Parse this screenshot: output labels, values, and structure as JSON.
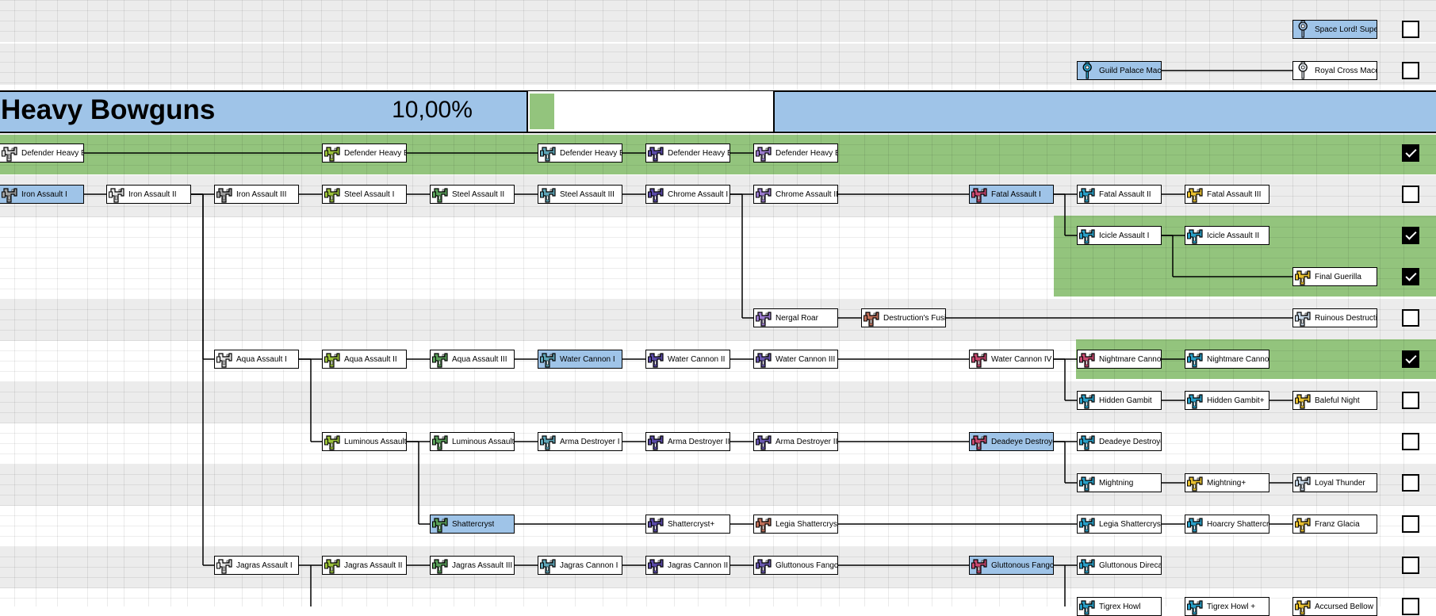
{
  "section": {
    "title": "Heavy Bowguns",
    "percent": "10,00%",
    "progress": 0.1
  },
  "colors": {
    "highlight": "#9fc4e8",
    "complete": "#93c47d",
    "grid_band": "#ececec",
    "icon_palette": [
      "#9e9e9e",
      "#e6e6e6",
      "#9bc23a",
      "#5aa05a",
      "#5fa6b8",
      "#6a58b0",
      "#9c7bd0",
      "#c0705a",
      "#c84a70",
      "#2aa0c8",
      "#e8c030",
      "#c8d8e8"
    ]
  },
  "icons": {
    "heavy_bowgun": "heavy-bowgun-icon",
    "hammer": "hammer-icon"
  },
  "weapon_nodes": [
    {
      "label": "Space Lord! Super-",
      "icon": "hammer-icon",
      "color": "#9bb8d8",
      "highlight": true
    },
    {
      "label": "Guild Palace Mace",
      "icon": "hammer-icon",
      "color": "#2aa0c8",
      "highlight": true
    },
    {
      "label": "Royal Cross Mace",
      "icon": "hammer-icon",
      "color": "#e8eef4",
      "highlight": false
    },
    {
      "label": "Defender Heavy Bo",
      "icon": "heavy-bowgun-icon",
      "color": "#d8d8d8",
      "highlight": false
    },
    {
      "label": "Defender Heavy Bo",
      "icon": "heavy-bowgun-icon",
      "color": "#9bc23a",
      "highlight": false
    },
    {
      "label": "Defender Heavy Bo",
      "icon": "heavy-bowgun-icon",
      "color": "#5fa6b8",
      "highlight": false
    },
    {
      "label": "Defender Heavy Bo",
      "icon": "heavy-bowgun-icon",
      "color": "#5a4aa8",
      "highlight": false
    },
    {
      "label": "Defender Heavy Bo",
      "icon": "heavy-bowgun-icon",
      "color": "#9c7bd0",
      "highlight": false
    },
    {
      "label": "Iron Assault I",
      "icon": "heavy-bowgun-icon",
      "color": "#9e9e9e",
      "highlight": true
    },
    {
      "label": "Iron Assault II",
      "icon": "heavy-bowgun-icon",
      "color": "#e6e6e6",
      "highlight": false
    },
    {
      "label": "Iron Assault III",
      "icon": "heavy-bowgun-icon",
      "color": "#9e9e9e",
      "highlight": false
    },
    {
      "label": "Steel Assault I",
      "icon": "heavy-bowgun-icon",
      "color": "#9bc23a",
      "highlight": false
    },
    {
      "label": "Steel Assault II",
      "icon": "heavy-bowgun-icon",
      "color": "#5aa05a",
      "highlight": false
    },
    {
      "label": "Steel Assault III",
      "icon": "heavy-bowgun-icon",
      "color": "#5fa6b8",
      "highlight": false
    },
    {
      "label": "Chrome Assault I",
      "icon": "heavy-bowgun-icon",
      "color": "#5a4aa8",
      "highlight": false
    },
    {
      "label": "Chrome Assault II",
      "icon": "heavy-bowgun-icon",
      "color": "#9c7bd0",
      "highlight": false
    },
    {
      "label": "Fatal Assault I",
      "icon": "heavy-bowgun-icon",
      "color": "#c84a70",
      "highlight": true
    },
    {
      "label": "Fatal Assault II",
      "icon": "heavy-bowgun-icon",
      "color": "#2aa0c8",
      "highlight": false
    },
    {
      "label": "Fatal Assault III",
      "icon": "heavy-bowgun-icon",
      "color": "#e8c030",
      "highlight": false
    },
    {
      "label": "Icicle Assault I",
      "icon": "heavy-bowgun-icon",
      "color": "#2aa0c8",
      "highlight": false
    },
    {
      "label": "Icicle Assault II",
      "icon": "heavy-bowgun-icon",
      "color": "#2aa0c8",
      "highlight": false
    },
    {
      "label": "Final Guerilla",
      "icon": "heavy-bowgun-icon",
      "color": "#e8c030",
      "highlight": false
    },
    {
      "label": "Nergal Roar",
      "icon": "heavy-bowgun-icon",
      "color": "#9c7bd0",
      "highlight": false
    },
    {
      "label": "Destruction's Fusill",
      "icon": "heavy-bowgun-icon",
      "color": "#c0705a",
      "highlight": false
    },
    {
      "label": "Ruinous Destruction",
      "icon": "heavy-bowgun-icon",
      "color": "#c8d8e8",
      "highlight": false
    },
    {
      "label": "Aqua Assault I",
      "icon": "heavy-bowgun-icon",
      "color": "#e6e6e6",
      "highlight": false
    },
    {
      "label": "Aqua Assault II",
      "icon": "heavy-bowgun-icon",
      "color": "#9bc23a",
      "highlight": false
    },
    {
      "label": "Aqua Assault III",
      "icon": "heavy-bowgun-icon",
      "color": "#5aa05a",
      "highlight": false
    },
    {
      "label": "Water Cannon I",
      "icon": "heavy-bowgun-icon",
      "color": "#5fa6b8",
      "highlight": true
    },
    {
      "label": "Water Cannon II",
      "icon": "heavy-bowgun-icon",
      "color": "#5a4aa8",
      "highlight": false
    },
    {
      "label": "Water Cannon III",
      "icon": "heavy-bowgun-icon",
      "color": "#6a58b0",
      "highlight": false
    },
    {
      "label": "Water Cannon IV",
      "icon": "heavy-bowgun-icon",
      "color": "#c84a70",
      "highlight": false
    },
    {
      "label": "Nightmare Cannon",
      "icon": "heavy-bowgun-icon",
      "color": "#c84a70",
      "highlight": false
    },
    {
      "label": "Nightmare Cannon",
      "icon": "heavy-bowgun-icon",
      "color": "#2aa0c8",
      "highlight": false
    },
    {
      "label": "Hidden Gambit",
      "icon": "heavy-bowgun-icon",
      "color": "#2aa0c8",
      "highlight": false
    },
    {
      "label": "Hidden Gambit+",
      "icon": "heavy-bowgun-icon",
      "color": "#2aa0c8",
      "highlight": false
    },
    {
      "label": "Baleful Night",
      "icon": "heavy-bowgun-icon",
      "color": "#e8c030",
      "highlight": false
    },
    {
      "label": "Luminous Assault I",
      "icon": "heavy-bowgun-icon",
      "color": "#9bc23a",
      "highlight": false
    },
    {
      "label": "Luminous Assault II",
      "icon": "heavy-bowgun-icon",
      "color": "#5aa05a",
      "highlight": false
    },
    {
      "label": "Arma Destroyer I",
      "icon": "heavy-bowgun-icon",
      "color": "#5fa6b8",
      "highlight": false
    },
    {
      "label": "Arma Destroyer II",
      "icon": "heavy-bowgun-icon",
      "color": "#5a4aa8",
      "highlight": false
    },
    {
      "label": "Arma Destroyer III",
      "icon": "heavy-bowgun-icon",
      "color": "#6a58b0",
      "highlight": false
    },
    {
      "label": "Deadeye Destroyer",
      "icon": "heavy-bowgun-icon",
      "color": "#c84a70",
      "highlight": true
    },
    {
      "label": "Deadeye Destroyer",
      "icon": "heavy-bowgun-icon",
      "color": "#2aa0c8",
      "highlight": false
    },
    {
      "label": "Mightning",
      "icon": "heavy-bowgun-icon",
      "color": "#2aa0c8",
      "highlight": false
    },
    {
      "label": "Mightning+",
      "icon": "heavy-bowgun-icon",
      "color": "#e8c030",
      "highlight": false
    },
    {
      "label": "Loyal Thunder",
      "icon": "heavy-bowgun-icon",
      "color": "#c8d8e8",
      "highlight": false
    },
    {
      "label": "Shattercryst",
      "icon": "heavy-bowgun-icon",
      "color": "#5aa05a",
      "highlight": true
    },
    {
      "label": "Shattercryst+",
      "icon": "heavy-bowgun-icon",
      "color": "#5a4aa8",
      "highlight": false
    },
    {
      "label": "Legia Shattercryst",
      "icon": "heavy-bowgun-icon",
      "color": "#c0705a",
      "highlight": false
    },
    {
      "label": "Legia Shattercryst+",
      "icon": "heavy-bowgun-icon",
      "color": "#2aa0c8",
      "highlight": false
    },
    {
      "label": "Hoarcry Shattercrys",
      "icon": "heavy-bowgun-icon",
      "color": "#2aa0c8",
      "highlight": false
    },
    {
      "label": "Franz Glacia",
      "icon": "heavy-bowgun-icon",
      "color": "#e8c030",
      "highlight": false
    },
    {
      "label": "Jagras Assault I",
      "icon": "heavy-bowgun-icon",
      "color": "#e6e6e6",
      "highlight": false
    },
    {
      "label": "Jagras Assault II",
      "icon": "heavy-bowgun-icon",
      "color": "#9bc23a",
      "highlight": false
    },
    {
      "label": "Jagras Assault III",
      "icon": "heavy-bowgun-icon",
      "color": "#5aa05a",
      "highlight": false
    },
    {
      "label": "Jagras Cannon I",
      "icon": "heavy-bowgun-icon",
      "color": "#5fa6b8",
      "highlight": false
    },
    {
      "label": "Jagras Cannon II",
      "icon": "heavy-bowgun-icon",
      "color": "#5a4aa8",
      "highlight": false
    },
    {
      "label": "Gluttonous Fangcar",
      "icon": "heavy-bowgun-icon",
      "color": "#6a58b0",
      "highlight": false
    },
    {
      "label": "Gluttonous Fangcar",
      "icon": "heavy-bowgun-icon",
      "color": "#c84a70",
      "highlight": true
    },
    {
      "label": "Gluttonous Direcan",
      "icon": "heavy-bowgun-icon",
      "color": "#2aa0c8",
      "highlight": false
    },
    {
      "label": "Tigrex Howl",
      "icon": "heavy-bowgun-icon",
      "color": "#2aa0c8",
      "highlight": false
    },
    {
      "label": "Tigrex Howl +",
      "icon": "heavy-bowgun-icon",
      "color": "#2aa0c8",
      "highlight": false
    },
    {
      "label": "Accursed Bellow",
      "icon": "heavy-bowgun-icon",
      "color": "#e8c030",
      "highlight": false
    }
  ],
  "row_checkboxes": [
    false,
    false,
    true,
    false,
    true,
    true,
    false,
    true,
    false,
    false,
    false,
    false,
    false,
    false
  ]
}
